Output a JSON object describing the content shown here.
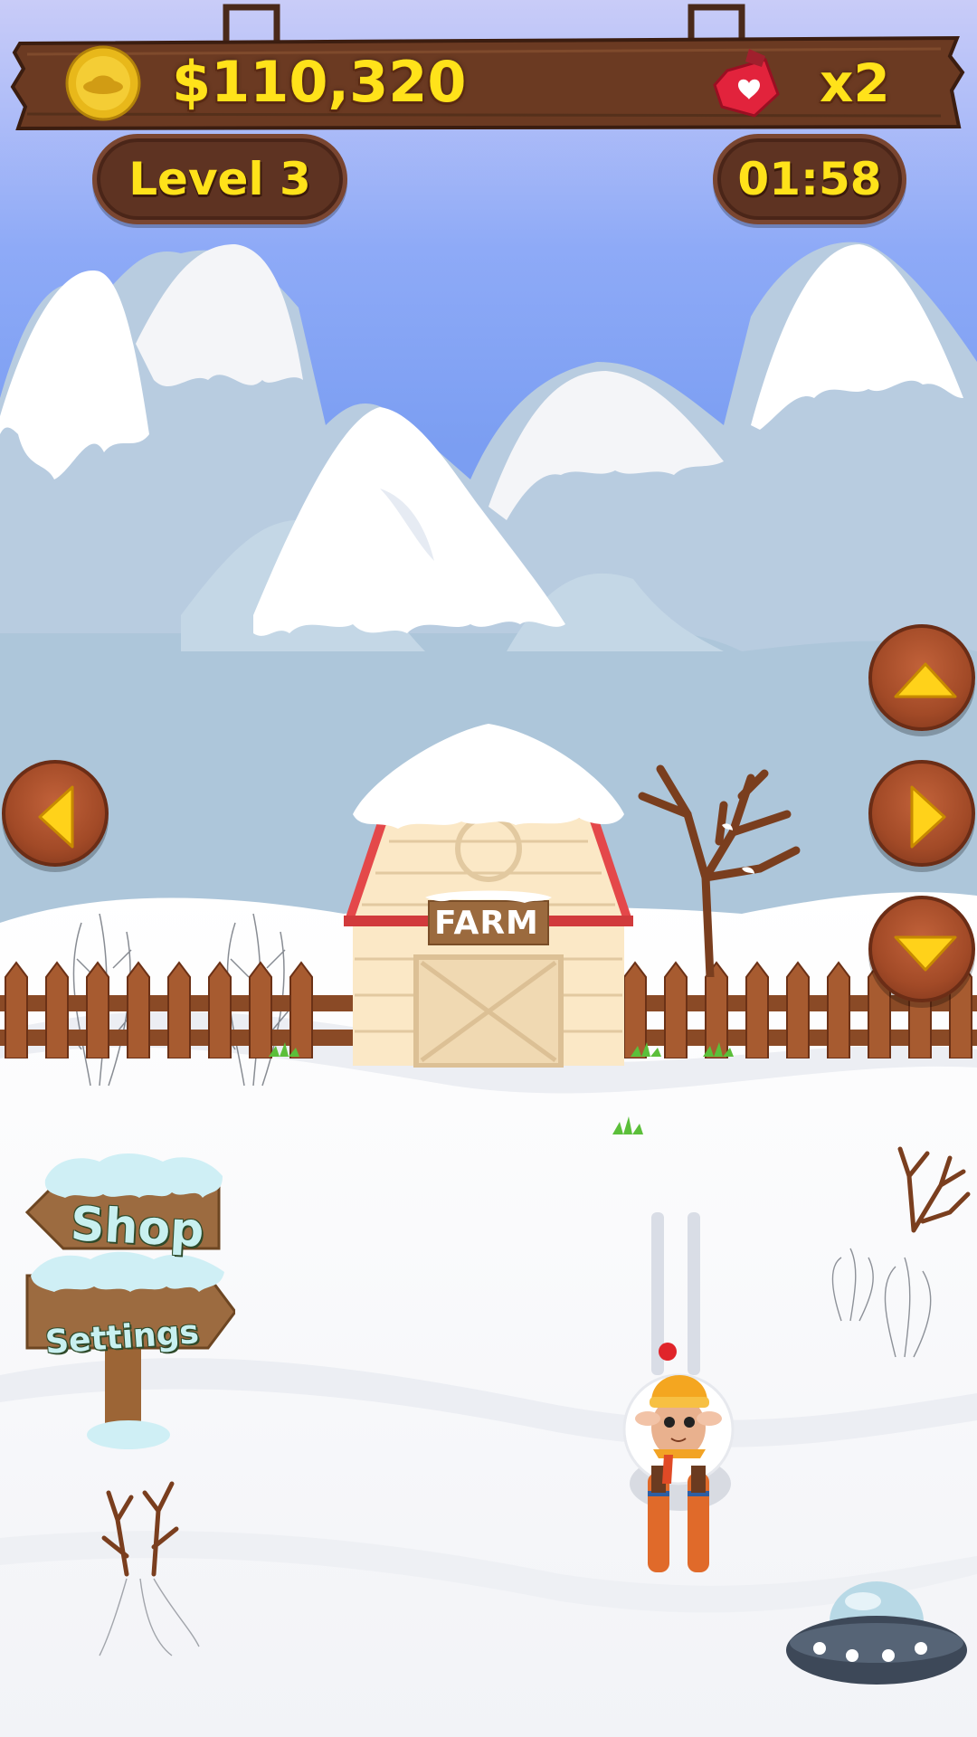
{
  "hud": {
    "money": "$110,320",
    "lives": "x2",
    "level": "Level 3",
    "timer": "01:58"
  },
  "scene": {
    "barn_label": "FARM"
  },
  "signpost": {
    "shop_label": "Shop",
    "settings_label": "Settings"
  },
  "colors": {
    "sky_top": "#c6caf8",
    "sky_mid": "#8aa8f6",
    "hud_text": "#ffe21a",
    "wood": "#7a3f22",
    "button": "#a24a27",
    "arrow": "#ffd21a"
  },
  "icons": {
    "coin": "coin-icon",
    "lives": "heart-bag-icon",
    "ufo": "ufo-icon",
    "up": "arrow-up-icon",
    "down": "arrow-down-icon",
    "left": "arrow-left-icon",
    "right": "arrow-right-icon"
  }
}
